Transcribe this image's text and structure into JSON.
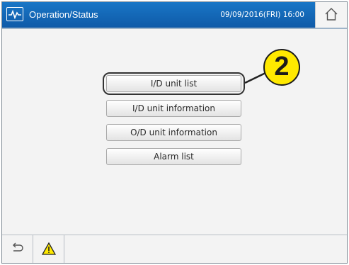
{
  "header": {
    "title": "Operation/Status",
    "datetime": "09/09/2016(FRI) 16:00",
    "app_icon": "pulse-wave-icon",
    "home_icon": "home-icon"
  },
  "menu": {
    "items": [
      {
        "label": "I/D unit list"
      },
      {
        "label": "I/D unit information"
      },
      {
        "label": "O/D unit information"
      },
      {
        "label": "Alarm list"
      }
    ]
  },
  "callout": {
    "number": "2",
    "color": "#ffe900"
  },
  "footer": {
    "back_icon": "return-arrow-icon",
    "alarm_icon": "warning-triangle-icon"
  },
  "colors": {
    "header": "#0f5aa8",
    "background": "#f3f3f3"
  }
}
